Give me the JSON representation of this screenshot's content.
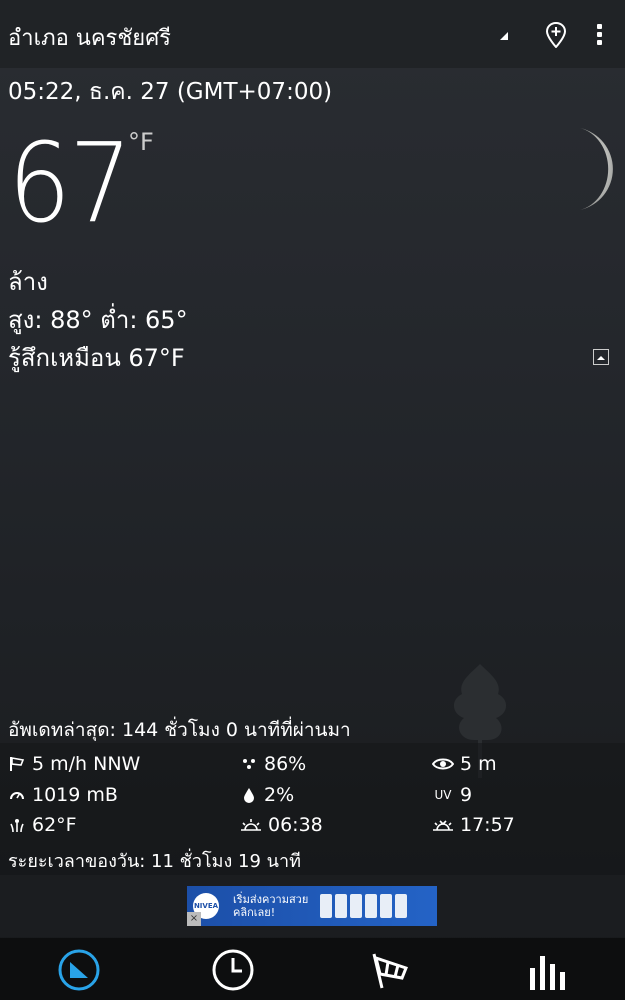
{
  "header": {
    "location": "อำเภอ นครชัยศรี",
    "icons": [
      "dropdown-triangle-icon",
      "add-location-pin-icon",
      "overflow-menu-icon"
    ]
  },
  "current": {
    "datetime": "05:22, ธ.ค. 27 (GMT+07:00)",
    "temperature": "67",
    "unit": "°F",
    "condition": "ล้าง",
    "high_low": "สูง: 88°  ต่ำ: 65°",
    "feels_like": "รู้สึกเหมือน 67°F"
  },
  "details": {
    "updated": "อัพเดทล่าสุด: 144 ชั่วโมง 0 นาทีที่ผ่านมา",
    "wind": "5 m/h NNW",
    "humidity": "86%",
    "visibility": "5 m",
    "pressure": "1019 mB",
    "precip": "2%",
    "uv_label": "UV",
    "uv": "9",
    "dew_point": "62°F",
    "sunrise": "06:38",
    "sunset": "17:57",
    "day_length": "ระยะเวลาของวัน: 11 ชั่วโมง 19 นาที"
  },
  "ad": {
    "brand": "NIVEA",
    "text_line1": "เริ่มส่งความสวย",
    "text_line2": "คลิกเลย!",
    "close": "×"
  },
  "nav": {
    "items": [
      "current-weather-tab",
      "hourly-forecast-tab",
      "wind-tab",
      "daily-forecast-tab"
    ],
    "active": 0,
    "accent": "#29a3e8"
  }
}
